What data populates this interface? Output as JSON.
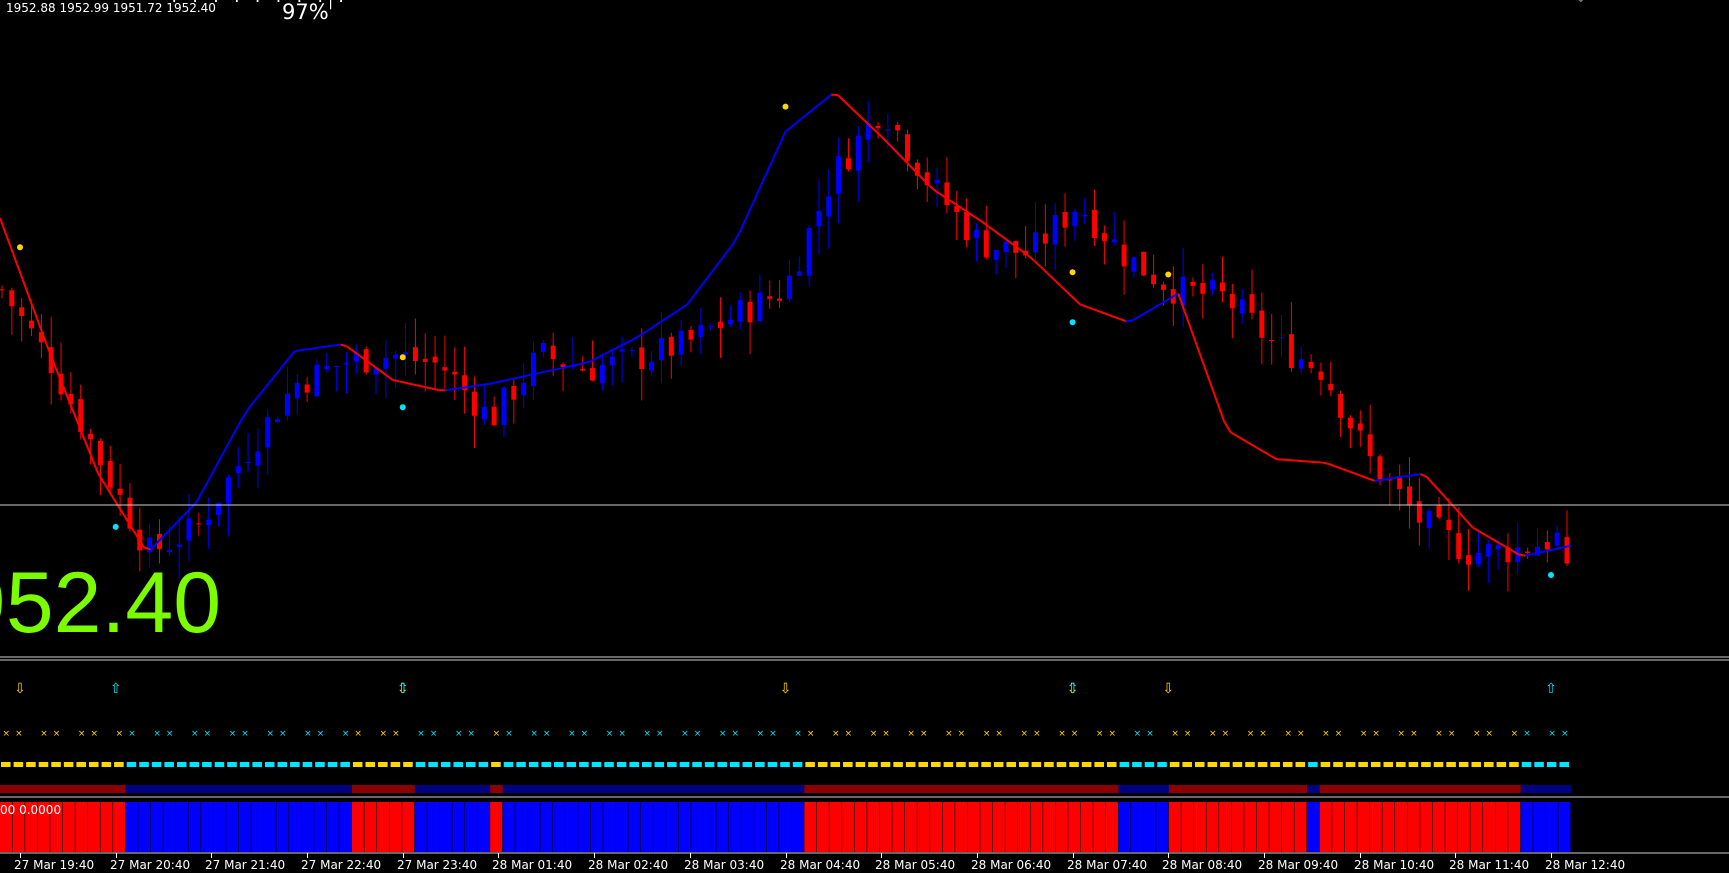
{
  "header": {
    "ohlc": "1952.88 1952.99 1951.72 1952.40",
    "dots": "· · · · · · · ·|·",
    "percent": "97%"
  },
  "big_price": "952.40",
  "sub_window": {
    "values": "00 0.0000"
  },
  "colors": {
    "background": "#000000",
    "bull": "#0000ff",
    "bear": "#ff0000",
    "ma_up": "#0000ff",
    "ma_down": "#ff0000",
    "signal_yellow": "#ffd700",
    "signal_cyan": "#00e5ff",
    "big_price": "#7cfc00"
  },
  "chart_data": {
    "type": "candlestick",
    "timeframe_minutes": 5,
    "x_ticks": [
      "27 Mar 19:40",
      "27 Mar 20:40",
      "27 Mar 21:40",
      "27 Mar 22:40",
      "27 Mar 23:40",
      "28 Mar 01:40",
      "28 Mar 02:40",
      "28 Mar 03:40",
      "28 Mar 04:40",
      "28 Mar 05:40",
      "28 Mar 06:40",
      "28 Mar 07:40",
      "28 Mar 08:40",
      "28 Mar 09:40",
      "28 Mar 10:40",
      "28 Mar 11:40",
      "28 Mar 12:40"
    ],
    "last_price": 1952.4,
    "close_path": [
      1960.0,
      1958.0,
      1955.3,
      1952.7,
      1953.4,
      1955.5,
      1957.4,
      1958.0,
      1958.2,
      1957.9,
      1956.4,
      1958.2,
      1957.8,
      1958.1,
      1958.5,
      1959.3,
      1960.0,
      1963.2,
      1965.1,
      1962.9,
      1961.3,
      1961.0,
      1962.4,
      1960.9,
      1960.0,
      1959.8,
      1958.5,
      1957.8,
      1955.2,
      1953.6,
      1952.7,
      1952.8,
      1953.2
    ],
    "ma_path": [
      1962.0,
      1958.3,
      1954.9,
      1952.7,
      1954.1,
      1956.6,
      1958.3,
      1958.5,
      1957.5,
      1957.2,
      1957.4,
      1957.7,
      1958.0,
      1958.7,
      1959.6,
      1961.4,
      1964.4,
      1965.5,
      1964.2,
      1962.8,
      1961.9,
      1960.9,
      1959.6,
      1959.1,
      1959.9,
      1956.1,
      1955.3,
      1955.2,
      1954.7,
      1954.9,
      1953.4,
      1952.6,
      1952.9
    ],
    "signals": [
      {
        "type": "sell",
        "time": "27 Mar 19:40"
      },
      {
        "type": "buy",
        "time": "27 Mar 20:40"
      },
      {
        "type": "sell",
        "time": "27 Mar 23:40"
      },
      {
        "type": "buy",
        "time": "27 Mar 23:40"
      },
      {
        "type": "sell",
        "time": "28 Mar 04:40"
      },
      {
        "type": "sell",
        "time": "28 Mar 07:40"
      },
      {
        "type": "buy",
        "time": "28 Mar 07:40"
      },
      {
        "type": "sell",
        "time": "28 Mar 08:40"
      },
      {
        "type": "buy",
        "time": "28 Mar 12:40"
      }
    ],
    "histogram_segments": [
      {
        "color": "red",
        "bars": 10
      },
      {
        "color": "blue",
        "bars": 18
      },
      {
        "color": "red",
        "bars": 5
      },
      {
        "color": "blue",
        "bars": 6
      },
      {
        "color": "red",
        "bars": 1
      },
      {
        "color": "blue",
        "bars": 24
      },
      {
        "color": "red",
        "bars": 25
      },
      {
        "color": "blue",
        "bars": 4
      },
      {
        "color": "red",
        "bars": 11
      },
      {
        "color": "blue",
        "bars": 1
      },
      {
        "color": "red",
        "bars": 16
      },
      {
        "color": "blue",
        "bars": 4
      }
    ]
  }
}
